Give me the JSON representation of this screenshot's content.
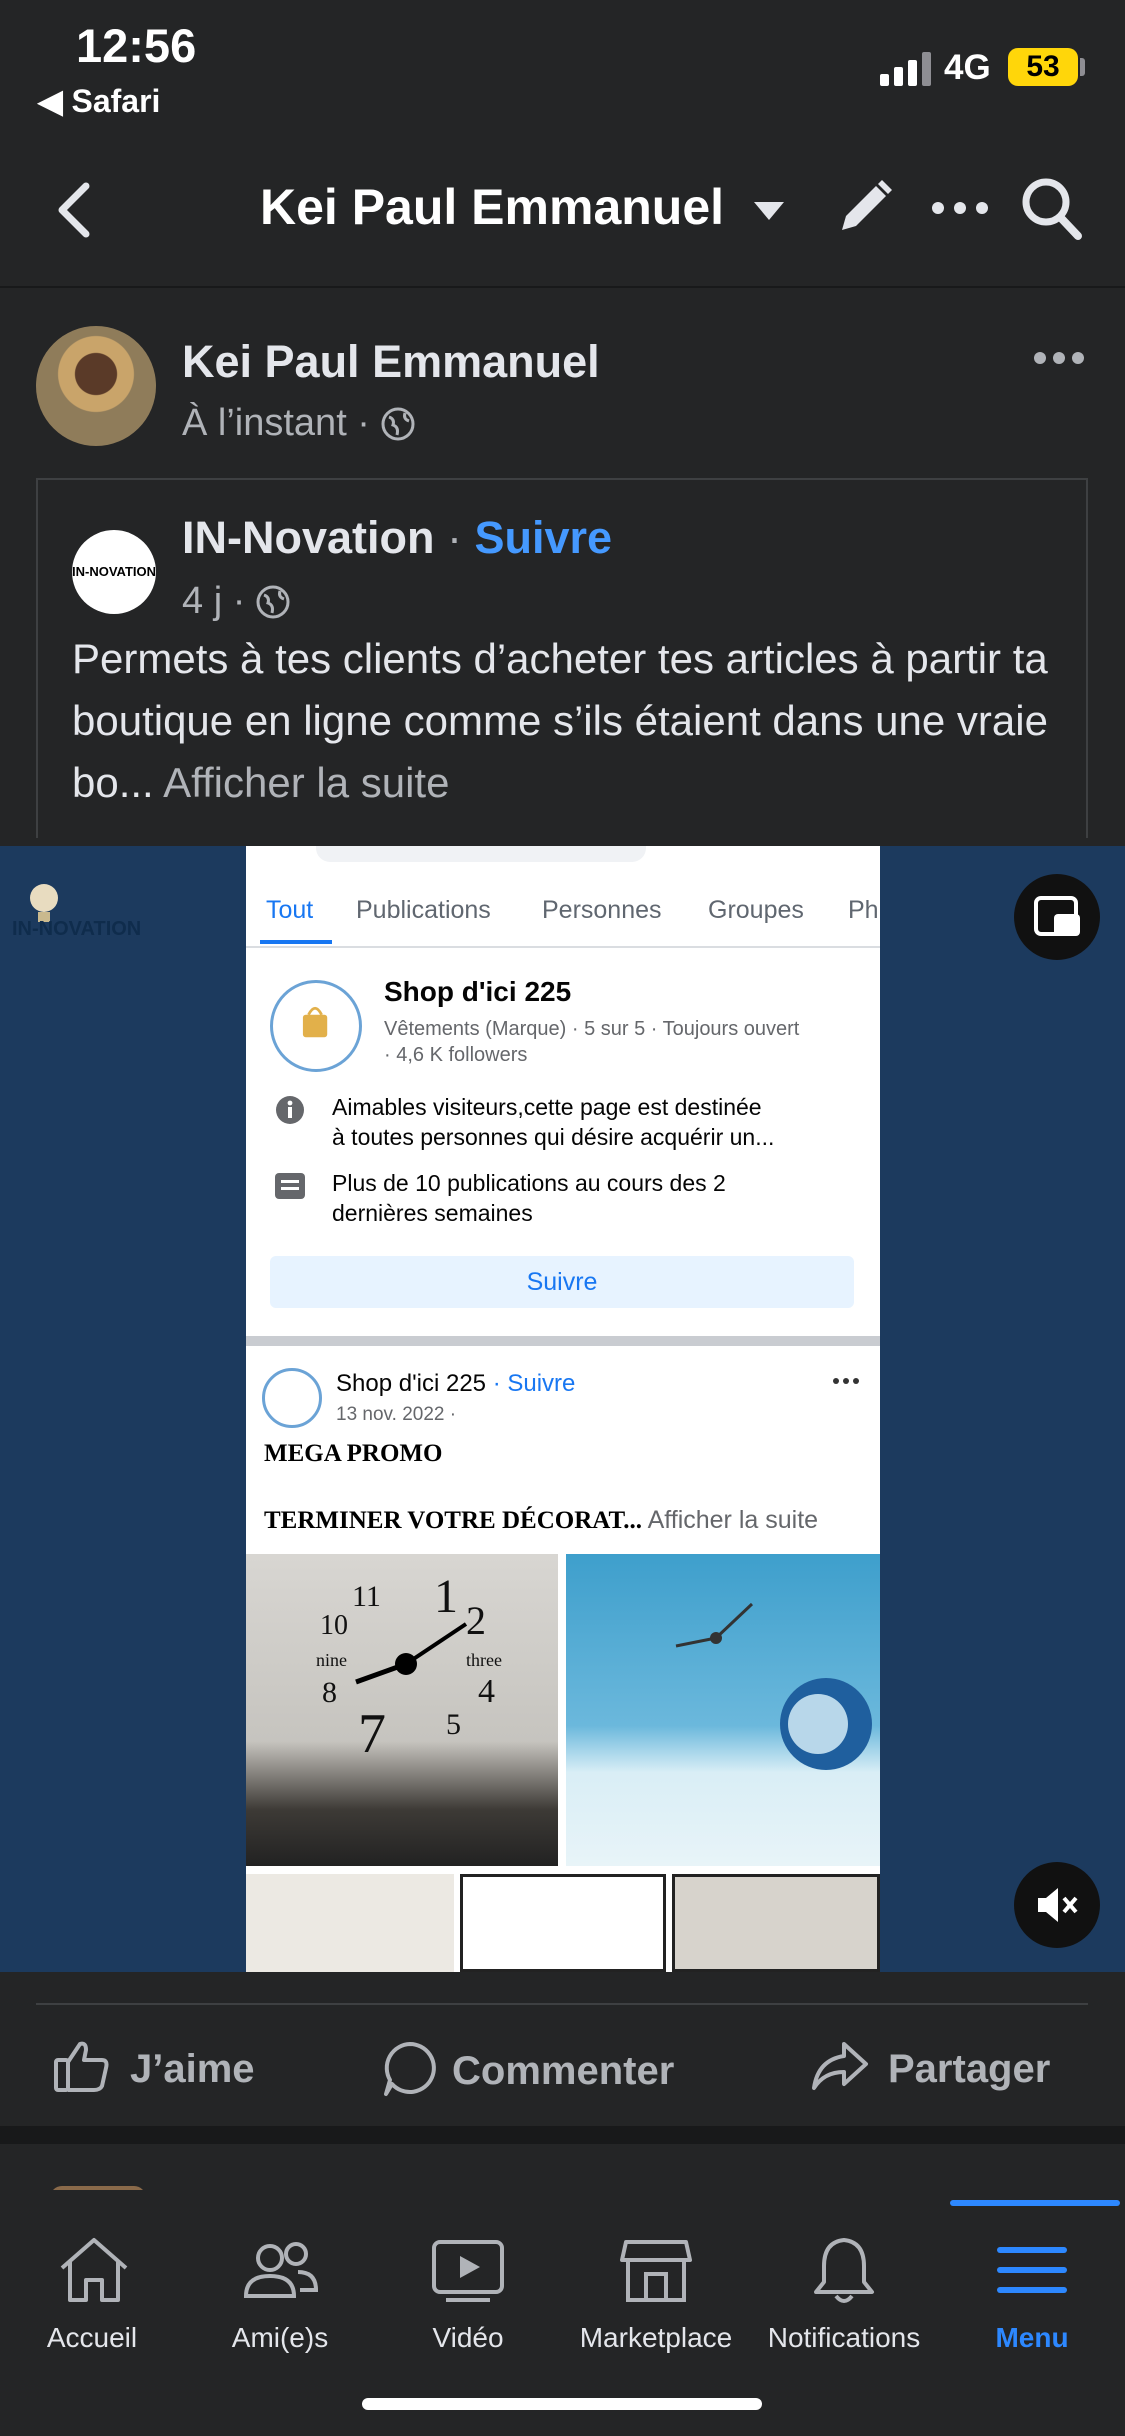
{
  "status": {
    "time": "12:56",
    "back_app": "◀ Safari",
    "network": "4G",
    "battery": "53"
  },
  "header": {
    "title": "Kei Paul Emmanuel"
  },
  "post": {
    "author": "Kei Paul Emmanuel",
    "meta": "À l’instant · ",
    "shared": {
      "page_name": "IN-Novation",
      "follow_sep": " · ",
      "follow": "Suivre",
      "meta": "4 j · ",
      "text": "Permets à tes clients d’acheter tes articles à partir ta boutique en ligne comme s’ils étaient dans une vraie bo... ",
      "see_more": "Afficher la suite",
      "avatar_text": "IN-NOVATION"
    }
  },
  "video": {
    "logo_text": "IN-NOVATION",
    "screen": {
      "tabs": [
        "Tout",
        "Publications",
        "Personnes",
        "Groupes",
        "Ph"
      ],
      "page_title": "Shop d'ici 225",
      "page_meta": "Vêtements (Marque) · 5 sur 5 · Toujours ouvert",
      "page_followers": "· 4,6 K followers",
      "info1_line1": "Aimables visiteurs,cette page est destinée",
      "info1_line2": "à toutes personnes qui désire acquérir un...",
      "info2_line1": "Plus de 10 publications au cours des 2",
      "info2_line2": "dernières semaines",
      "follow_btn": "Suivre",
      "post_name": "Shop d'ici 225",
      "post_follow": " · Suivre",
      "post_date": "13 nov. 2022 · ",
      "post_title": "MEGA PROMO",
      "post_body": "TERMINER VOTRE DÉCORAT...",
      "post_more": " Afficher la suite",
      "clock_numbers": [
        "11",
        "1",
        "10",
        "2",
        "nine",
        "three",
        "8",
        "4",
        "7",
        "5"
      ]
    }
  },
  "actions": {
    "like": "J’aime",
    "comment": "Commenter",
    "share": "Partager"
  },
  "nav": [
    {
      "label": "Accueil",
      "icon": "home-icon"
    },
    {
      "label": "Ami(e)s",
      "icon": "friends-icon"
    },
    {
      "label": "Vidéo",
      "icon": "video-icon"
    },
    {
      "label": "Marketplace",
      "icon": "marketplace-icon"
    },
    {
      "label": "Notifications",
      "icon": "bell-icon"
    },
    {
      "label": "Menu",
      "icon": "menu-icon",
      "active": true
    }
  ],
  "colors": {
    "accent": "#2d88ff",
    "background": "#242526",
    "video_bg": "#1c3a5e"
  }
}
